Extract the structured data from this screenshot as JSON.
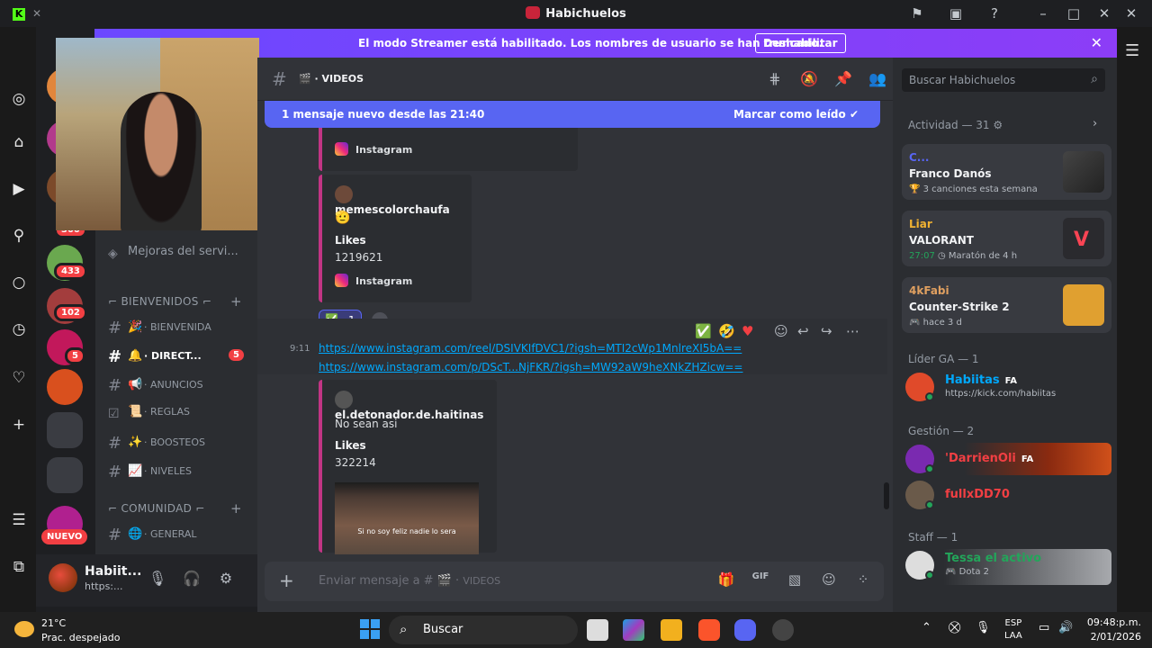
{
  "window": {
    "title": "Habichuelos"
  },
  "banner": {
    "text": "El modo Streamer está habilitado. Los nombres de usuario se han truncado.",
    "button": "Deshabilitar"
  },
  "servers": {
    "badges": [
      "300",
      "433",
      "102",
      "5"
    ],
    "nuevo": "NUEVO"
  },
  "sidebar": {
    "partial_item": "Mejoras del servi...",
    "cat1": "BIENVENIDOS",
    "cat2": "COMUNIDAD",
    "channels": [
      {
        "name": "BIENVENIDA",
        "emoji": "🎉"
      },
      {
        "name": "DIRECT...",
        "emoji": "🔔",
        "badge": "5"
      },
      {
        "name": "ANUNCIOS",
        "emoji": "📢"
      },
      {
        "name": "REGLAS",
        "emoji": "📜"
      },
      {
        "name": "BOOSTEOS",
        "emoji": "✨"
      },
      {
        "name": "NIVELES",
        "emoji": "📈"
      },
      {
        "name": "GENERAL",
        "emoji": "🌐"
      }
    ]
  },
  "user": {
    "name": "Habiit...",
    "status": "https:..."
  },
  "channel": {
    "name": "VIDEOS",
    "emoji": "🎬"
  },
  "newbar": {
    "left": "1 mensaje nuevo desde las 21:40",
    "right": "Marcar como leído"
  },
  "messages": {
    "embed1_footer": "Instagram",
    "embed2": {
      "author": "memescolorchaufa",
      "emoji": "🫡",
      "field": "Likes",
      "value": "1219621",
      "footer": "Instagram"
    },
    "reaction": {
      "emoji": "✅",
      "count": "1"
    },
    "time": "9:11",
    "link1": "https://www.instagram.com/reel/DSIVKIfDVC1/?igsh=MTI2cWp1MnlreXI5bA==",
    "link2": "https://www.instagram.com/p/DScT...NjFKR/?igsh=MW92aW9heXNkZHZicw==",
    "embed3": {
      "author": "el.detonador.de.haitinas",
      "text": "No sean asi",
      "field": "Likes",
      "value": "322214",
      "thumb_caption": "Si no soy feliz nadie lo sera"
    }
  },
  "input": {
    "placeholder": "Enviar mensaje a #",
    "channel": "VIDEOS"
  },
  "right": {
    "search": "Buscar Habichuelos",
    "activity": "Actividad — 31",
    "cards": [
      {
        "user": "C...",
        "title": "Franco Danós",
        "sub": "3 canciones esta semana",
        "color": "#5865f2"
      },
      {
        "user": "Liar",
        "title": "VALORANT",
        "time": "27:07",
        "sub": "Maratón de 4 h",
        "color": "#f0b232"
      },
      {
        "user": "4kFabi",
        "title": "Counter-Strike 2",
        "sub": "hace 3 d",
        "color": "#e0a060"
      }
    ],
    "sections": [
      {
        "title": "Líder GA — 1"
      },
      {
        "title": "Gestión — 2"
      },
      {
        "title": "Staff — 1"
      }
    ],
    "members": [
      {
        "name": "Habiitas",
        "tag": "FA",
        "sub": "https://kick.com/habiitas",
        "color": "#00a8fc"
      },
      {
        "name": "'DarrienOli",
        "tag": "FA",
        "sub": "",
        "color": "#f23f43"
      },
      {
        "name": "fullxDD70",
        "tag": "",
        "sub": "",
        "color": "#f23f43"
      },
      {
        "name": "Tessa el activo",
        "tag": "",
        "sub": "Dota 2",
        "color": "#23a55a"
      }
    ]
  },
  "taskbar": {
    "temp": "21°C",
    "weather": "Prac. despejado",
    "search": "Buscar",
    "lang1": "ESP",
    "lang2": "LAA",
    "time": "09:48:p.m.",
    "date": "2/01/2026"
  }
}
